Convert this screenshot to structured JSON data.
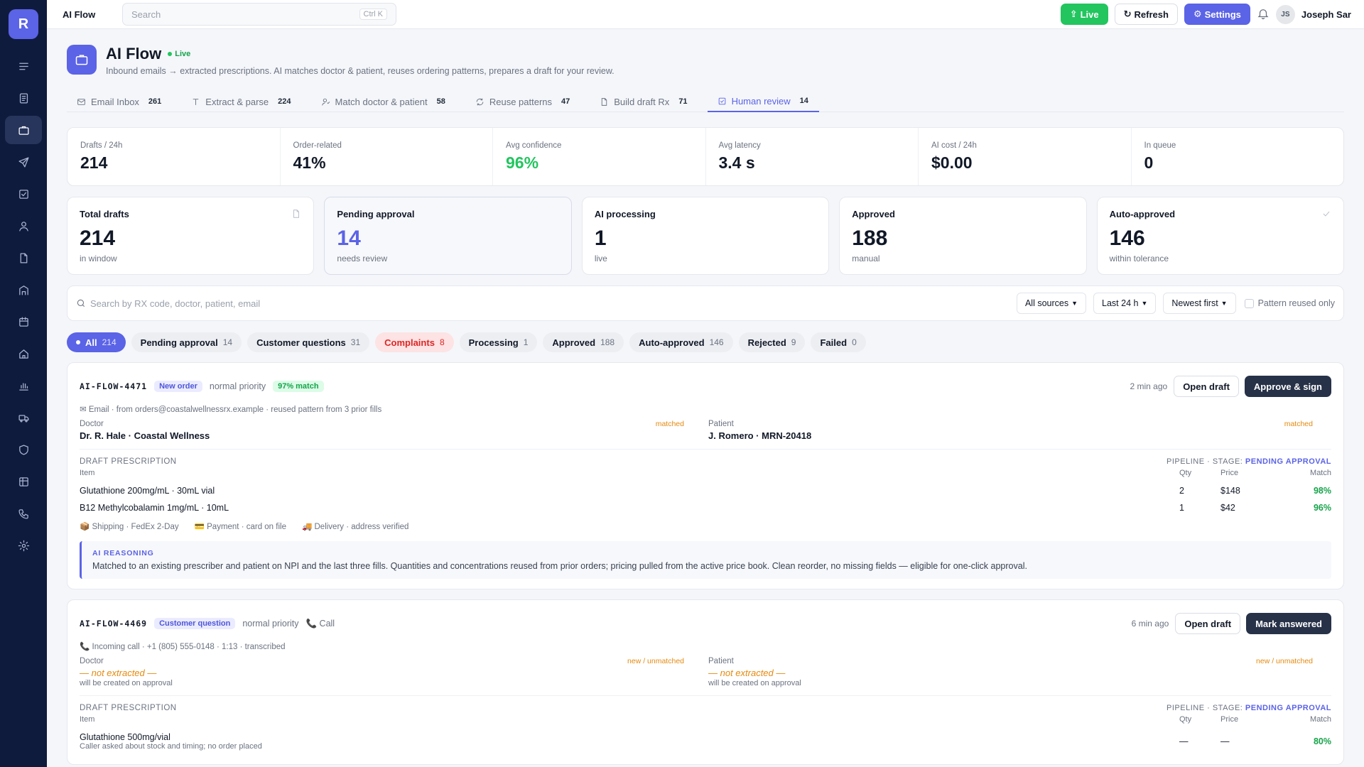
{
  "sidebar": {
    "logo": "R",
    "items": [
      {
        "icon": "menu-icon"
      },
      {
        "icon": "document-list-icon"
      },
      {
        "icon": "briefcase-icon",
        "active": true
      },
      {
        "icon": "send-icon"
      },
      {
        "icon": "check-square-icon"
      },
      {
        "icon": "user-icon"
      },
      {
        "icon": "file-icon"
      },
      {
        "icon": "building-icon"
      },
      {
        "icon": "calendar-icon"
      },
      {
        "icon": "home-icon"
      },
      {
        "icon": "bar-chart-icon"
      },
      {
        "icon": "truck-icon"
      },
      {
        "icon": "shield-icon"
      },
      {
        "icon": "table-icon"
      },
      {
        "icon": "phone-icon"
      },
      {
        "icon": "gear-icon"
      }
    ]
  },
  "topbar": {
    "title": "AI Flow",
    "search_placeholder": "Search",
    "search_shortcut": "Ctrl K",
    "live_label": "Live",
    "refresh_label": "Refresh",
    "settings_label": "Settings",
    "avatar_initials": "JS",
    "user_name": "Joseph Sar"
  },
  "header": {
    "title": "AI Flow",
    "live": "Live",
    "subtitle": "Inbound emails → extracted prescriptions. AI matches doctor & patient, reuses ordering patterns, prepares a draft for your review."
  },
  "tabs": [
    {
      "label": "Email Inbox",
      "count": "261",
      "icon": "mail-icon"
    },
    {
      "label": "Extract & parse",
      "count": "224",
      "icon": "text-icon"
    },
    {
      "label": "Match doctor & patient",
      "count": "58",
      "icon": "user-match-icon"
    },
    {
      "label": "Reuse patterns",
      "count": "47",
      "icon": "refresh-icon"
    },
    {
      "label": "Build draft Rx",
      "count": "71",
      "icon": "file-icon"
    },
    {
      "label": "Human review",
      "count": "14",
      "icon": "check-square-icon",
      "active": true
    }
  ],
  "stats": [
    {
      "label": "Drafts / 24h",
      "value": "214"
    },
    {
      "label": "Order-related",
      "value": "41%"
    },
    {
      "label": "Avg confidence",
      "value": "96%",
      "color": "#22c55e"
    },
    {
      "label": "Avg latency",
      "value": "3.4 s"
    },
    {
      "label": "AI cost / 24h",
      "value": "$0.00"
    },
    {
      "label": "In queue",
      "value": "0"
    }
  ],
  "cards": [
    {
      "label": "Total drafts",
      "value": "214",
      "sub": "in window",
      "icon": "file-icon"
    },
    {
      "label": "Pending approval",
      "value": "14",
      "sub": "needs review"
    },
    {
      "label": "AI processing",
      "value": "1",
      "sub": "live"
    },
    {
      "label": "Approved",
      "value": "188",
      "sub": "manual"
    },
    {
      "label": "Auto-approved",
      "value": "146",
      "sub": "within tolerance",
      "icon": "check-icon"
    }
  ],
  "filters": {
    "search_placeholder": "Search by RX code, doctor, patient, email",
    "source": "All sources",
    "window": "Last 24 h",
    "sort": "Newest first",
    "pattern_only": "Pattern reused only"
  },
  "pills": [
    {
      "label": "All",
      "count": "214"
    },
    {
      "label": "Pending approval",
      "count": "14"
    },
    {
      "label": "Customer questions",
      "count": "31"
    },
    {
      "label": "Complaints",
      "count": "8"
    },
    {
      "label": "Processing",
      "count": "1"
    },
    {
      "label": "Approved",
      "count": "188"
    },
    {
      "label": "Auto-approved",
      "count": "146"
    },
    {
      "label": "Rejected",
      "count": "9"
    },
    {
      "label": "Failed",
      "count": "0"
    }
  ],
  "items": [
    {
      "code": "AI-FLOW-4471",
      "tag": "New order",
      "priority": "normal priority",
      "match_tag": "97% match",
      "ago": "2 min ago",
      "open_label": "Open draft",
      "action_label": "Approve & sign",
      "source": "✉ Email · from orders@coastalwellnessrx.example · reused pattern from 3 prior fills",
      "doctor_label": "Doctor",
      "doctor": "Dr. R. Hale · Coastal Wellness",
      "doctor_status": "matched",
      "patient_label": "Patient",
      "patient": "J. Romero · MRN-20418",
      "patient_status": "matched",
      "draft_title": "DRAFT PRESCRIPTION",
      "pipeline_prefix": "PIPELINE · STAGE:",
      "pipeline_stage": "PENDING APPROVAL",
      "columns": {
        "item": "Item",
        "qty": "Qty",
        "price": "Price",
        "match": "Match"
      },
      "rows": [
        {
          "item": "Glutathione 200mg/mL · 30mL vial",
          "qty": "2",
          "price": "$148",
          "match": "98%"
        },
        {
          "item": "B12 Methylcobalamin 1mg/mL · 10mL",
          "qty": "1",
          "price": "$42",
          "match": "96%"
        }
      ],
      "meta": [
        "📦 Shipping · FedEx 2-Day",
        "💳 Payment · card on file",
        "🚚 Delivery · address verified"
      ],
      "reason_title": "AI REASONING",
      "reason": "Matched to an existing prescriber and patient on NPI and the last three fills. Quantities and concentrations reused from prior orders; pricing pulled from the active price book. Clean reorder, no missing fields — eligible for one-click approval."
    },
    {
      "code": "AI-FLOW-4469",
      "tag": "Customer question",
      "priority": "normal priority",
      "channel": "📞 Call",
      "ago": "6 min ago",
      "open_label": "Open draft",
      "action_label": "Mark answered",
      "source": "📞 Incoming call · +1 (805) 555-0148 · 1:13 · transcribed",
      "doctor_label": "Doctor",
      "doctor": "— not extracted —",
      "doctor_note": "will be created on approval",
      "doctor_status": "new / unmatched",
      "patient_label": "Patient",
      "patient": "— not extracted —",
      "patient_note": "will be created on approval",
      "patient_status": "new / unmatched",
      "draft_title": "DRAFT PRESCRIPTION",
      "pipeline_prefix": "PIPELINE · STAGE:",
      "pipeline_stage": "PENDING APPROVAL",
      "columns": {
        "item": "Item",
        "qty": "Qty",
        "price": "Price",
        "match": "Match"
      },
      "rows": [
        {
          "item": "Glutathione 500mg/vial",
          "note": "Caller asked about stock and timing; no order placed",
          "qty": "—",
          "price": "—",
          "match": "80%"
        }
      ]
    }
  ]
}
